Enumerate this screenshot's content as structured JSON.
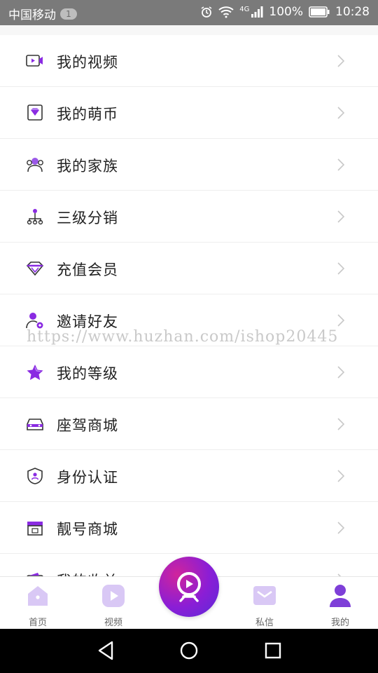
{
  "status_bar": {
    "carrier": "中国移动",
    "notification_count": "1",
    "network_type": "4G",
    "battery": "100%",
    "time": "10:28"
  },
  "menu": {
    "items": [
      {
        "label": "我的视频",
        "icon": "video-icon"
      },
      {
        "label": "我的萌币",
        "icon": "gem-icon"
      },
      {
        "label": "我的家族",
        "icon": "family-icon"
      },
      {
        "label": "三级分销",
        "icon": "distribution-icon"
      },
      {
        "label": "充值会员",
        "icon": "diamond-icon"
      },
      {
        "label": "邀请好友",
        "icon": "invite-icon"
      },
      {
        "label": "我的等级",
        "icon": "star-icon"
      },
      {
        "label": "座驾商城",
        "icon": "car-icon"
      },
      {
        "label": "身份认证",
        "icon": "shield-icon"
      },
      {
        "label": "靓号商城",
        "icon": "store-icon"
      },
      {
        "label": "我的收益",
        "icon": "wallet-icon"
      }
    ]
  },
  "watermark": "https://www.huzhan.com/ishop20445",
  "tabbar": {
    "home": "首页",
    "video": "视频",
    "messages": "私信",
    "mine": "我的"
  },
  "colors": {
    "accent": "#8a2be2",
    "icon_light": "#d9c8f5",
    "icon_dark": "#7e3fd8"
  }
}
